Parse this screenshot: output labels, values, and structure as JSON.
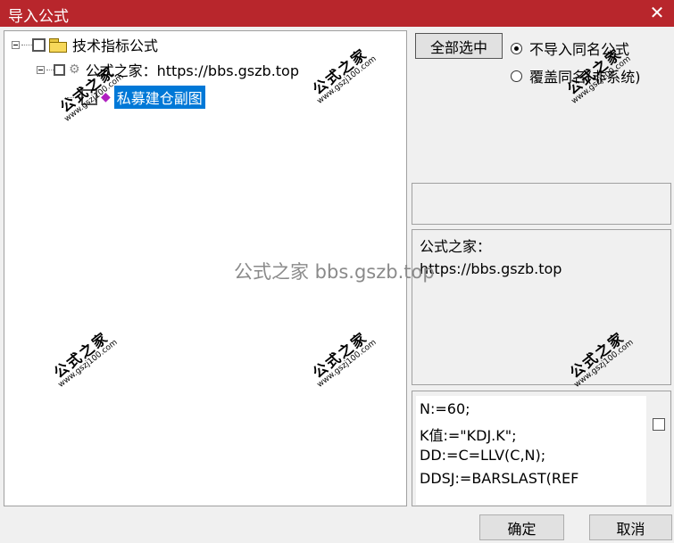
{
  "window": {
    "title": "导入公式",
    "close_glyph": "✕",
    "title_color": "#b8262c"
  },
  "tree": {
    "root_label": "技术指标公式",
    "group_label": "公式之家：https://bbs.gszb.top",
    "item_label": "私募建仓副图",
    "selected_color": "#0078d7"
  },
  "options": {
    "select_all_label": "全部选中",
    "radio_no_import_label": "不导入同名公式",
    "radio_overwrite_label": "覆盖同名(非系统)",
    "selected_radio": "不导入同名公式"
  },
  "description": {
    "line1": "公式之家：",
    "line2": "https://bbs.gszb.top"
  },
  "code": {
    "lines": [
      "N:=60;",
      "K值:=\"KDJ.K\";",
      "DD:=C=LLV(C,N);",
      "DDSJ:=BARSLAST(REF"
    ]
  },
  "footer": {
    "ok_label": "确定",
    "cancel_label": "取消"
  },
  "watermark": {
    "title": "公式之家",
    "url": "www.gszj100.com",
    "center_text": "公式之家 bbs.gszb.top"
  }
}
